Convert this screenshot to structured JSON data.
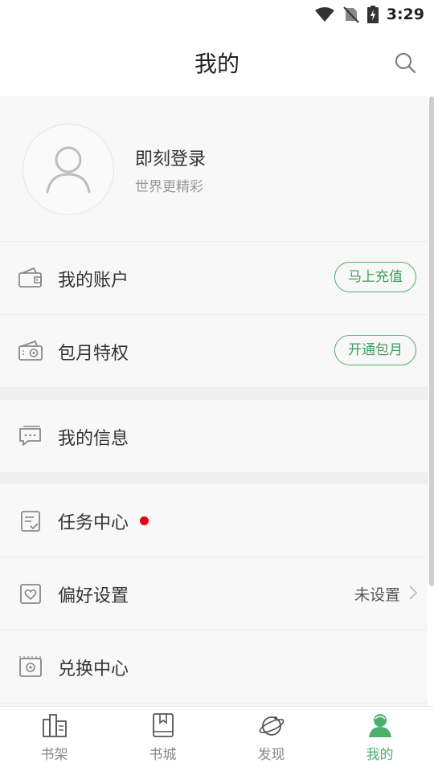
{
  "status_bar": {
    "time": "3:29"
  },
  "header": {
    "title": "我的"
  },
  "profile": {
    "title": "即刻登录",
    "subtitle": "世界更精彩"
  },
  "menu": [
    {
      "label": "我的账户",
      "button": "马上充值"
    },
    {
      "label": "包月特权",
      "button": "开通包月"
    },
    {
      "label": "我的信息"
    },
    {
      "label": "任务中心"
    },
    {
      "label": "偏好设置",
      "value": "未设置"
    },
    {
      "label": "兑换中心"
    }
  ],
  "nav": [
    {
      "label": "书架"
    },
    {
      "label": "书城"
    },
    {
      "label": "发现"
    },
    {
      "label": "我的"
    }
  ],
  "colors": {
    "accent": "#4caf6c",
    "notify_dot": "#e60012"
  }
}
